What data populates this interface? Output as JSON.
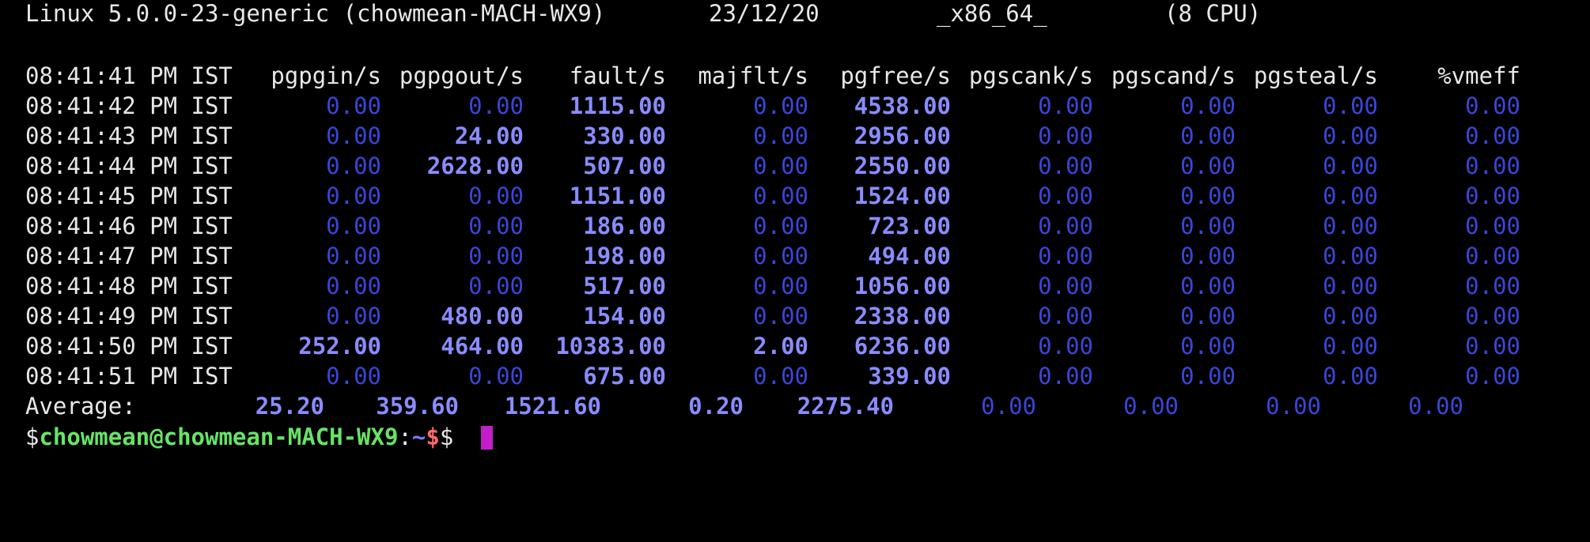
{
  "terminal": {
    "sysinfo": {
      "kernel": "Linux 5.0.0-23-generic (chowmean-MACH-WX9)",
      "date": "23/12/20",
      "arch": "_x86_64_",
      "cpus": "(8 CPU)"
    },
    "headers": [
      "08:41:41 PM IST",
      "pgpgin/s",
      "pgpgout/s",
      "fault/s",
      "majflt/s",
      "pgfree/s",
      "pgscank/s",
      "pgscand/s",
      "pgsteal/s",
      "%vmeff"
    ],
    "rows": [
      {
        "time": "08:41:42 PM IST",
        "values": [
          "0.00",
          "0.00",
          "1115.00",
          "0.00",
          "4538.00",
          "0.00",
          "0.00",
          "0.00",
          "0.00"
        ]
      },
      {
        "time": "08:41:43 PM IST",
        "values": [
          "0.00",
          "24.00",
          "330.00",
          "0.00",
          "2956.00",
          "0.00",
          "0.00",
          "0.00",
          "0.00"
        ]
      },
      {
        "time": "08:41:44 PM IST",
        "values": [
          "0.00",
          "2628.00",
          "507.00",
          "0.00",
          "2550.00",
          "0.00",
          "0.00",
          "0.00",
          "0.00"
        ]
      },
      {
        "time": "08:41:45 PM IST",
        "values": [
          "0.00",
          "0.00",
          "1151.00",
          "0.00",
          "1524.00",
          "0.00",
          "0.00",
          "0.00",
          "0.00"
        ]
      },
      {
        "time": "08:41:46 PM IST",
        "values": [
          "0.00",
          "0.00",
          "186.00",
          "0.00",
          "723.00",
          "0.00",
          "0.00",
          "0.00",
          "0.00"
        ]
      },
      {
        "time": "08:41:47 PM IST",
        "values": [
          "0.00",
          "0.00",
          "198.00",
          "0.00",
          "494.00",
          "0.00",
          "0.00",
          "0.00",
          "0.00"
        ]
      },
      {
        "time": "08:41:48 PM IST",
        "values": [
          "0.00",
          "0.00",
          "517.00",
          "0.00",
          "1056.00",
          "0.00",
          "0.00",
          "0.00",
          "0.00"
        ]
      },
      {
        "time": "08:41:49 PM IST",
        "values": [
          "0.00",
          "480.00",
          "154.00",
          "0.00",
          "2338.00",
          "0.00",
          "0.00",
          "0.00",
          "0.00"
        ]
      },
      {
        "time": "08:41:50 PM IST",
        "values": [
          "252.00",
          "464.00",
          "10383.00",
          "2.00",
          "6236.00",
          "0.00",
          "0.00",
          "0.00",
          "0.00"
        ]
      },
      {
        "time": "08:41:51 PM IST",
        "values": [
          "0.00",
          "0.00",
          "675.00",
          "0.00",
          "339.00",
          "0.00",
          "0.00",
          "0.00",
          "0.00"
        ]
      }
    ],
    "average": {
      "label": "Average:",
      "values": [
        "25.20",
        "359.60",
        "1521.60",
        "0.20",
        "2275.40",
        "0.00",
        "0.00",
        "0.00",
        "0.00"
      ]
    },
    "prompt": {
      "prefix": "$",
      "user_host": "chowmean@chowmean-MACH-WX9",
      "colon": ":",
      "path": "~",
      "dollar": "$",
      "symbol": "$ "
    },
    "colors": {
      "background": "#000000",
      "text": "#e8e8e8",
      "zero_value": "#3a46d6",
      "nonzero_value": "#8a8cff",
      "prompt_user": "#66e466",
      "prompt_path": "#7a7aff",
      "prompt_dollar": "#ff6b6b",
      "cursor": "#c21fc9"
    }
  }
}
